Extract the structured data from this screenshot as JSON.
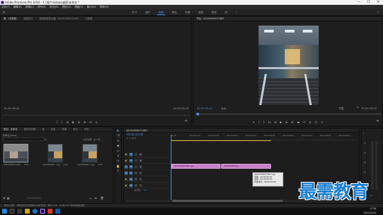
{
  "titlebar": {
    "text": "Adobe Premiere Pro 2020 - C:\\用户\\rblsqx\\桌面\\未命名 *",
    "min": "—",
    "max": "☐",
    "close": "✕"
  },
  "menu": [
    "文件(F)",
    "编辑(E)",
    "剪辑(C)",
    "序列(S)",
    "标记(M)",
    "图形(G)",
    "视图(V)",
    "窗口(W)",
    "帮助(H)"
  ],
  "workspaces": {
    "tabs": [
      "学习",
      "组件",
      "编辑",
      "颜色",
      "效果",
      "音频",
      "图形",
      "库"
    ],
    "active_index": 2,
    "more": "»"
  },
  "source_panel": {
    "tabs": [
      "源：(无剪辑)",
      "效果控件",
      "音频剪辑混合器：00150509071667",
      "元数据"
    ],
    "timecode_left": "00:00:00:00",
    "timecode_right": "00:00:00:00"
  },
  "program_panel": {
    "tab": "节目：00150509071667",
    "timecode_left": "00:00:00:00",
    "fit": "适合",
    "quality": "完整",
    "timecode_right": "00:00:00:00"
  },
  "project_panel": {
    "tabs": [
      "项目：未命名",
      "媒体浏览器",
      "库",
      "信息",
      "效果",
      "标记",
      "历史"
    ],
    "path": "未命名.prproj",
    "count": "1 项已选择，共 3 项",
    "items": [
      {
        "name": "00150509071667",
        "duration": "5:00"
      },
      {
        "name": "0015050907...jpg",
        "duration": "5:00"
      },
      {
        "name": "0015050907...jpg",
        "duration": "5:00"
      }
    ]
  },
  "tools": [
    "▶",
    "⇉",
    "↔",
    "◆",
    "✂",
    "↕",
    "✎",
    "✋",
    "T"
  ],
  "timeline": {
    "tab": "00150509071667",
    "timecode": "00:00:00:00",
    "ruler": [
      "00:00",
      "00:00:01:00",
      "00:00:02:00",
      "00:00:03:00",
      "00:00:04:00",
      "00:00:05:00",
      "00:00:06:00",
      "00:00:07:00",
      "00:00:08:00",
      "00:00:09:00"
    ],
    "tracks": {
      "video": [
        "V3",
        "V2",
        "V1"
      ],
      "audio": [
        "A1",
        "A2",
        "A3"
      ],
      "master": "主声道",
      "master_value": "0.0"
    },
    "clips": [
      "00150509071667.jpg",
      "0015050907.jpg"
    ]
  },
  "tooltip": {
    "lines": [
      "00150509071667.jpg",
      "开始：00:00:00:00",
      "结束：00:00:04:29",
      "持续时间：00:00:05:00"
    ]
  },
  "meters": {
    "labels": [
      "0",
      "-12",
      "-24",
      "-36",
      "-48",
      "dB"
    ],
    "bottom": "S  S"
  },
  "status": "单击以选择，或单击空白处并拖动以进行框选。使用 Shift、Alt 和 Ctrl 可获得其他选项。",
  "watermark": "最需教育",
  "clock": {
    "time": "17:36",
    "date": "2021/10/24"
  }
}
